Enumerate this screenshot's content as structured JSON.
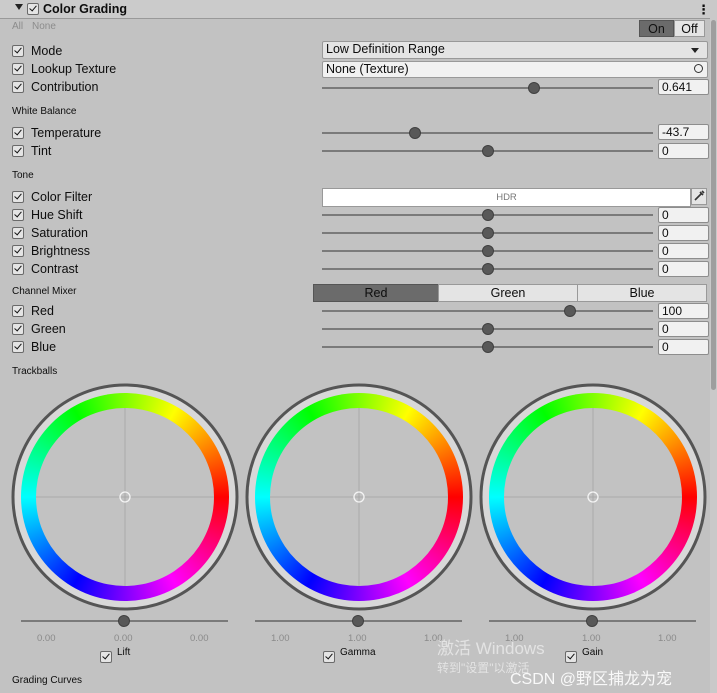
{
  "header": {
    "title": "Color Grading",
    "all": "All",
    "none": "None",
    "on": "On",
    "off": "Off"
  },
  "mode": {
    "label": "Mode",
    "value": "Low Definition Range"
  },
  "lookup": {
    "label": "Lookup Texture",
    "value": "None (Texture)"
  },
  "contribution": {
    "label": "Contribution",
    "value": "0.641",
    "fraction": 0.641
  },
  "white_balance": {
    "title": "White Balance",
    "temperature": {
      "label": "Temperature",
      "value": "-43.7",
      "fraction": 0.2815
    },
    "tint": {
      "label": "Tint",
      "value": "0",
      "fraction": 0.5
    }
  },
  "tone": {
    "title": "Tone",
    "color_filter": {
      "label": "Color Filter",
      "value": "HDR"
    },
    "hue_shift": {
      "label": "Hue Shift",
      "value": "0",
      "fraction": 0.5
    },
    "saturation": {
      "label": "Saturation",
      "value": "0",
      "fraction": 0.5
    },
    "brightness": {
      "label": "Brightness",
      "value": "0",
      "fraction": 0.5
    },
    "contrast": {
      "label": "Contrast",
      "value": "0",
      "fraction": 0.5
    }
  },
  "channel_mixer": {
    "title": "Channel Mixer",
    "tabs": [
      "Red",
      "Green",
      "Blue"
    ],
    "active_tab": 0,
    "red": {
      "label": "Red",
      "value": "100",
      "fraction": 0.75
    },
    "green": {
      "label": "Green",
      "value": "0",
      "fraction": 0.5
    },
    "blue": {
      "label": "Blue",
      "value": "0",
      "fraction": 0.5
    }
  },
  "trackballs": {
    "title": "Trackballs",
    "lift": {
      "label": "Lift",
      "values": [
        "0.00",
        "0.00",
        "0.00"
      ]
    },
    "gamma": {
      "label": "Gamma",
      "values": [
        "1.00",
        "1.00",
        "1.00"
      ]
    },
    "gain": {
      "label": "Gain",
      "values": [
        "1.00",
        "1.00",
        "1.00"
      ]
    }
  },
  "grading_curves": {
    "title": "Grading Curves"
  },
  "watermark": {
    "activate_title": "激活 Windows",
    "activate_sub": "转到\"设置\"以激活",
    "csdn": "CSDN @野区捕龙为宠"
  },
  "colors": {
    "active_tab": "#6b6b6b",
    "knob": "#585858",
    "track": "#7a7a7a"
  }
}
